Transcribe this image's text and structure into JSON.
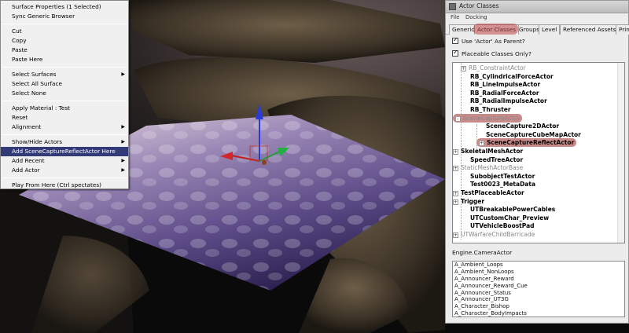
{
  "context_menu": {
    "items": [
      {
        "label": "Surface Properties (1 Selected)",
        "submenu": false,
        "highlighted": false
      },
      {
        "label": "Sync Generic Browser",
        "submenu": false,
        "highlighted": false
      },
      {
        "separator": true
      },
      {
        "label": "Cut",
        "submenu": false,
        "highlighted": false
      },
      {
        "label": "Copy",
        "submenu": false,
        "highlighted": false
      },
      {
        "label": "Paste",
        "submenu": false,
        "highlighted": false
      },
      {
        "label": "Paste Here",
        "submenu": false,
        "highlighted": false
      },
      {
        "separator": true
      },
      {
        "label": "Select Surfaces",
        "submenu": true,
        "highlighted": false
      },
      {
        "label": "Select All Surface",
        "submenu": false,
        "highlighted": false
      },
      {
        "label": "Select None",
        "submenu": false,
        "highlighted": false
      },
      {
        "separator": true
      },
      {
        "label": "Apply Material : Test",
        "submenu": false,
        "highlighted": false
      },
      {
        "label": "Reset",
        "submenu": false,
        "highlighted": false
      },
      {
        "label": "Alignment",
        "submenu": true,
        "highlighted": false
      },
      {
        "separator": true
      },
      {
        "label": "Show/Hide Actors",
        "submenu": true,
        "highlighted": false
      },
      {
        "label": "Add SceneCaptureReflectActor Here",
        "submenu": false,
        "highlighted": true
      },
      {
        "label": "Add Recent",
        "submenu": true,
        "highlighted": false
      },
      {
        "label": "Add Actor",
        "submenu": true,
        "highlighted": false
      },
      {
        "separator": true
      },
      {
        "label": "Play From Here (Ctrl spectates)",
        "submenu": false,
        "highlighted": false
      }
    ]
  },
  "window": {
    "title": "Actor Classes",
    "menu": [
      "File",
      "Docking"
    ],
    "tabs": [
      {
        "label": "Generic",
        "active": false
      },
      {
        "label": "Actor Classes",
        "active": true
      },
      {
        "label": "Groups",
        "active": false
      },
      {
        "label": "Level",
        "active": false
      },
      {
        "label": "Referenced Assets",
        "active": false
      },
      {
        "label": "Prim",
        "active": false
      }
    ],
    "checkboxes": [
      {
        "label": "Use 'Actor' As Parent?",
        "checked": true
      },
      {
        "label": "Placeable Classes Only?",
        "checked": true
      }
    ],
    "tree": [
      {
        "label": "RB_ConstraintActor",
        "indent": 1,
        "expander": "+",
        "style": "grey"
      },
      {
        "label": "RB_CylindricalForceActor",
        "indent": 1,
        "expander": "",
        "style": "bold"
      },
      {
        "label": "RB_LineImpulseActor",
        "indent": 1,
        "expander": "",
        "style": "bold"
      },
      {
        "label": "RB_RadialForceActor",
        "indent": 1,
        "expander": "",
        "style": "bold"
      },
      {
        "label": "RB_RadialImpulseActor",
        "indent": 1,
        "expander": "",
        "style": "bold"
      },
      {
        "label": "RB_Thruster",
        "indent": 1,
        "expander": "",
        "style": "bold"
      },
      {
        "label": "SceneCaptureActor",
        "indent": 0,
        "expander": "-",
        "style": "grey-highlight"
      },
      {
        "label": "SceneCapture2DActor",
        "indent": 2,
        "expander": "",
        "style": "bold"
      },
      {
        "label": "SceneCaptureCubeMapActor",
        "indent": 2,
        "expander": "",
        "style": "bold"
      },
      {
        "label": "SceneCaptureReflectActor",
        "indent": 2,
        "expander": "+",
        "style": "bold-highlight"
      },
      {
        "label": "SkeletalMeshActor",
        "indent": 0,
        "expander": "+",
        "style": "bold"
      },
      {
        "label": "SpeedTreeActor",
        "indent": 1,
        "expander": "",
        "style": "bold"
      },
      {
        "label": "StaticMeshActorBase",
        "indent": 0,
        "expander": "+",
        "style": "grey"
      },
      {
        "label": "SubobjectTestActor",
        "indent": 1,
        "expander": "",
        "style": "bold"
      },
      {
        "label": "Test0023_MetaData",
        "indent": 1,
        "expander": "",
        "style": "bold"
      },
      {
        "label": "TestPlaceableActor",
        "indent": 0,
        "expander": "+",
        "style": "bold"
      },
      {
        "label": "Trigger",
        "indent": 0,
        "expander": "+",
        "style": "bold"
      },
      {
        "label": "UTBreakablePowerCables",
        "indent": 1,
        "expander": "",
        "style": "bold"
      },
      {
        "label": "UTCustomChar_Preview",
        "indent": 1,
        "expander": "",
        "style": "bold"
      },
      {
        "label": "UTVehicleBoostPad",
        "indent": 1,
        "expander": "",
        "style": "bold"
      },
      {
        "label": "UTWarfareChildBarricade",
        "indent": 0,
        "expander": "+",
        "style": "grey"
      }
    ],
    "selected_class": "Engine.CameraActor",
    "list": [
      "A_Ambient_Loops",
      "A_Ambient_NonLoops",
      "A_Announcer_Reward",
      "A_Announcer_Reward_Cue",
      "A_Announcer_Status",
      "A_Announcer_UT3G",
      "A_Character_Bishop",
      "A_Character_BodyImpacts"
    ]
  },
  "colors": {
    "menu_highlight": "#333a78",
    "tab_highlight": "#b43c3c",
    "tree_highlight": "#c98a8a"
  }
}
